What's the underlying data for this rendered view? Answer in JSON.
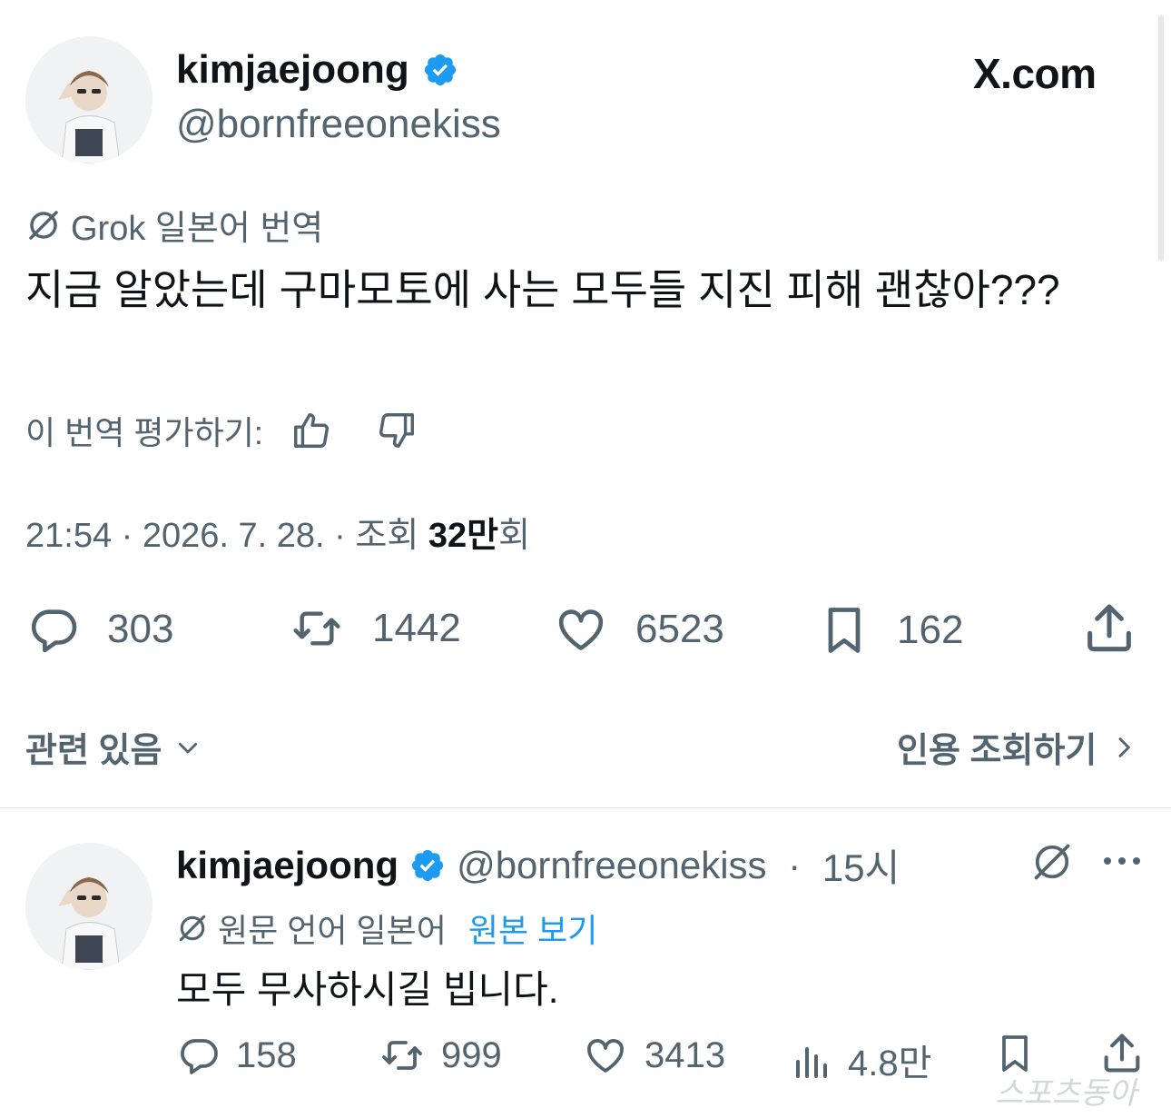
{
  "main_tweet": {
    "display_name": "kimjaejoong",
    "handle": "@bornfreeonekiss",
    "site_label": "X.com",
    "translation_label": "Grok 일본어 번역",
    "text": "지금 알았는데 구마모토에 사는 모두들 지진 피해 괜찮아???",
    "rate_translation_label": "이 번역 평가하기:",
    "timestamp": "21:54 · 2026. 7. 28. · 조회 ",
    "views_count": "32만",
    "views_unit": "회",
    "stats": {
      "replies": "303",
      "reposts": "1442",
      "likes": "6523",
      "bookmarks": "162"
    },
    "related_label": "관련 있음",
    "view_quotes_label": "인용 조회하기"
  },
  "reply": {
    "display_name": "kimjaejoong",
    "handle": "@bornfreeonekiss",
    "time_sep": " · ",
    "time": "15시",
    "original_language_label": "원문 언어 일본어",
    "view_original_label": "원본 보기",
    "text": "모두 무사하시길 빕니다.",
    "stats": {
      "replies": "158",
      "reposts": "999",
      "likes": "3413",
      "views": "4.8만"
    }
  },
  "watermark": "스포츠동아",
  "colors": {
    "text": "#0f1419",
    "secondary": "#536471",
    "link": "#1d9bf0",
    "verified": "#1d9bf0"
  },
  "icons": [
    "verified-badge-icon",
    "grok-icon",
    "thumbs-up-icon",
    "thumbs-down-icon",
    "reply-icon",
    "repost-icon",
    "like-icon",
    "bookmark-icon",
    "share-icon",
    "chevron-down-icon",
    "chevron-right-icon",
    "views-icon",
    "more-icon"
  ]
}
